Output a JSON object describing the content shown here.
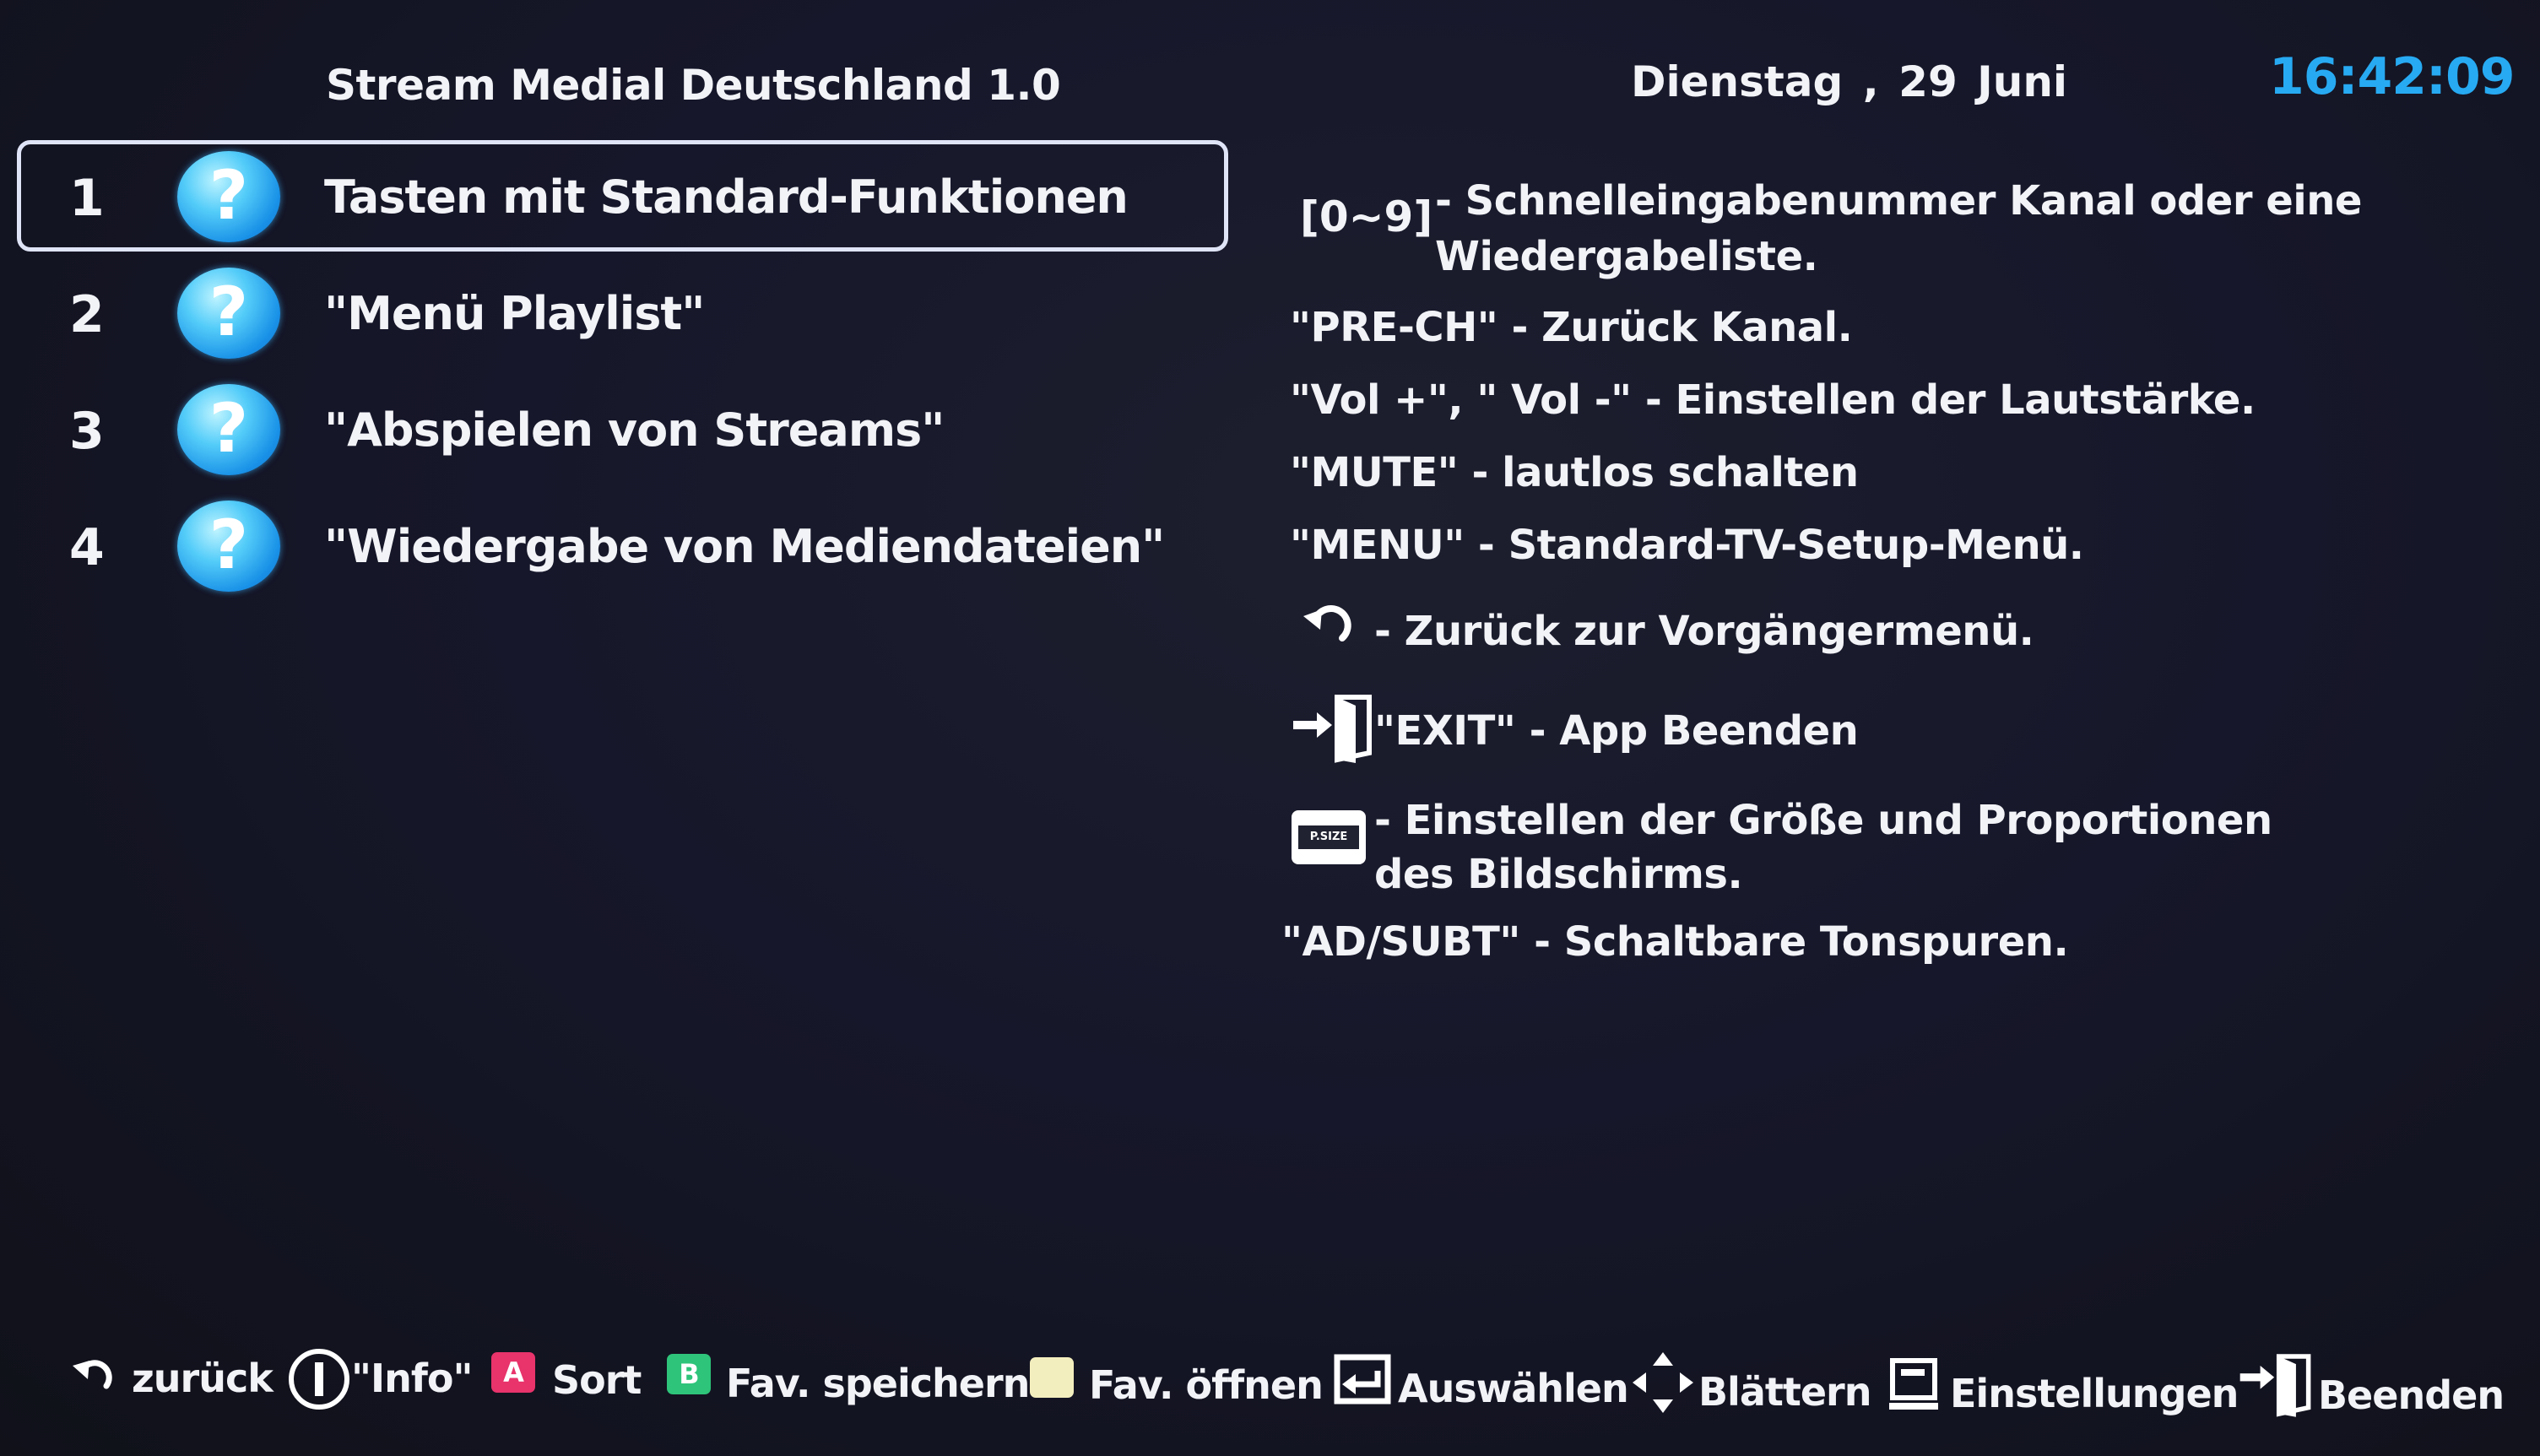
{
  "header": {
    "title": "Stream Medial Deutschland 1.0",
    "date": "Dienstag , 29 Juni",
    "time": "16:42:09"
  },
  "menu": {
    "items": [
      {
        "number": "1",
        "label": "Tasten mit Standard-Funktionen",
        "icon": "help-icon",
        "selected": true
      },
      {
        "number": "2",
        "label": "\"Menü Playlist\"",
        "icon": "help-icon",
        "selected": false
      },
      {
        "number": "3",
        "label": "\"Abspielen von Streams\"",
        "icon": "help-icon",
        "selected": false
      },
      {
        "number": "4",
        "label": "\"Wiedergabe von Mediendateien\"",
        "icon": "help-icon",
        "selected": false
      }
    ],
    "icon_glyph": "?"
  },
  "info": {
    "digits_key": "[0~9]",
    "digits_text": "- Schnelleingabenummer Kanal oder eine Wiedergabeliste.",
    "prech": "\"PRE-CH\" - Zurück Kanal.",
    "vol": "\"Vol +\", \" Vol -\" - Einstellen der Lautstärke.",
    "mute": "\"MUTE\" - lautlos schalten",
    "menu": "\"MENU\" - Standard-TV-Setup-Menü.",
    "return": "- Zurück zur Vorgängermenü.",
    "exit": "\"EXIT\" - App Beenden",
    "psize_key": "P.SIZE",
    "psize": "- Einstellen der Größe und Proportionen des Bildschirms.",
    "adsubt": "\"AD/SUBT\" - Schaltbare Tonspuren."
  },
  "bottom_bar": {
    "back": "zurück",
    "info": "\"Info\"",
    "a_key": "A",
    "sort": "Sort",
    "b_key": "B",
    "fav_save": "Fav. speichern",
    "fav_open": "Fav. öffnen",
    "select": "Auswählen",
    "scroll": "Blättern",
    "settings": "Einstellungen",
    "exit": "Beenden"
  },
  "colors": {
    "background": "#14151f",
    "text": "#f2f3f7",
    "clock": "#27aaf2",
    "key_red": "#e8336b",
    "key_green": "#2ec47a",
    "key_yellow": "#f3eebe",
    "help_icon": "#3fb8f5"
  }
}
